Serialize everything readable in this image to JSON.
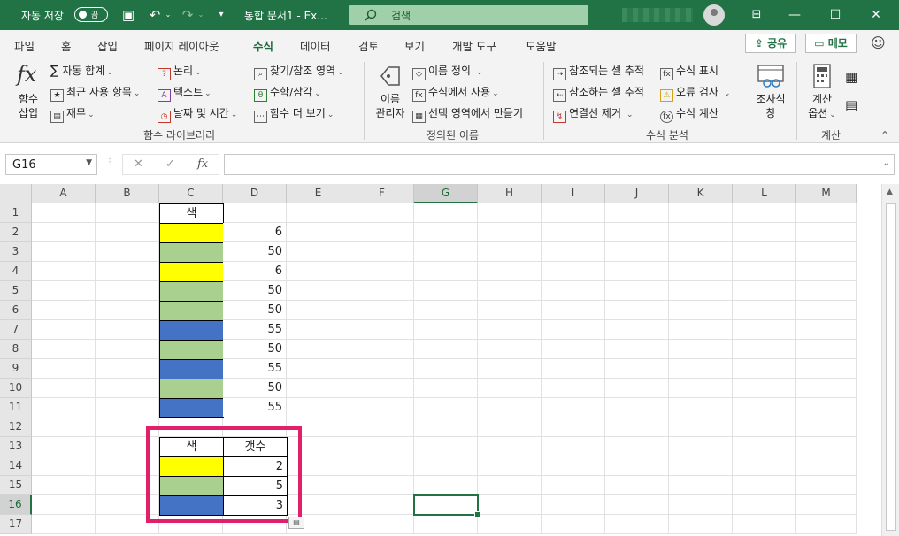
{
  "titlebar": {
    "autosave_label": "자동 저장",
    "autosave_state": "끔",
    "doc_title": "통합 문서1 - Ex...",
    "search_placeholder": "검색",
    "minimize": "—",
    "restore": "☐",
    "close": "✕"
  },
  "tabs": [
    "파일",
    "홈",
    "삽입",
    "페이지 레이아웃",
    "수식",
    "데이터",
    "검토",
    "보기",
    "개발 도구",
    "도움말"
  ],
  "active_tab": "수식",
  "share_label": "공유",
  "memo_label": "메모",
  "ribbon": {
    "insert_function": [
      "함수",
      "삽입"
    ],
    "library": {
      "autosum": "자동 합계",
      "recent": "최근 사용 항목",
      "financial": "재무",
      "logical": "논리",
      "text": "텍스트",
      "datetime": "날짜 및 시간",
      "lookup": "찾기/참조 영역",
      "math": "수학/삼각",
      "more": "함수 더 보기",
      "group_label": "함수 라이브러리"
    },
    "names": {
      "manager": [
        "이름",
        "관리자"
      ],
      "define": "이름 정의",
      "use_in_formula": "수식에서 사용",
      "create_from_selection": "선택 영역에서 만들기",
      "group_label": "정의된 이름"
    },
    "audit": {
      "trace_precedents": "참조되는 셀 추적",
      "trace_dependents": "참조하는 셀 추적",
      "remove_arrows": "연결선 제거",
      "show_formulas": "수식 표시",
      "error_check": "오류 검사",
      "evaluate": "수식 계산",
      "watch": [
        "조사식",
        "창"
      ],
      "group_label": "수식 분석"
    },
    "calc": {
      "options": [
        "계산",
        "옵션"
      ],
      "group_label": "계산"
    }
  },
  "namebox": "G16",
  "formula_value": "",
  "columns": [
    "A",
    "B",
    "C",
    "D",
    "E",
    "F",
    "G",
    "H",
    "I",
    "J",
    "K",
    "L",
    "M"
  ],
  "selected_column": "G",
  "rows": [
    "1",
    "2",
    "3",
    "4",
    "5",
    "6",
    "7",
    "8",
    "9",
    "10",
    "11",
    "12",
    "13",
    "14",
    "15",
    "16",
    "17"
  ],
  "selected_row": "16",
  "colors": {
    "yellow": "#ffff00",
    "green": "#a9d08e",
    "blue": "#4472c4",
    "excel_green": "#217346",
    "highlight": "#e0206a"
  },
  "table1": {
    "header": "색",
    "rows": [
      {
        "color": "yellow",
        "value": "6"
      },
      {
        "color": "green",
        "value": "50"
      },
      {
        "color": "yellow",
        "value": "6"
      },
      {
        "color": "green",
        "value": "50"
      },
      {
        "color": "green",
        "value": "50"
      },
      {
        "color": "blue",
        "value": "55"
      },
      {
        "color": "green",
        "value": "50"
      },
      {
        "color": "blue",
        "value": "55"
      },
      {
        "color": "green",
        "value": "50"
      },
      {
        "color": "blue",
        "value": "55"
      }
    ]
  },
  "table2": {
    "header_color": "색",
    "header_count": "갯수",
    "rows": [
      {
        "color": "yellow",
        "count": "2"
      },
      {
        "color": "green",
        "count": "5"
      },
      {
        "color": "blue",
        "count": "3"
      }
    ]
  }
}
